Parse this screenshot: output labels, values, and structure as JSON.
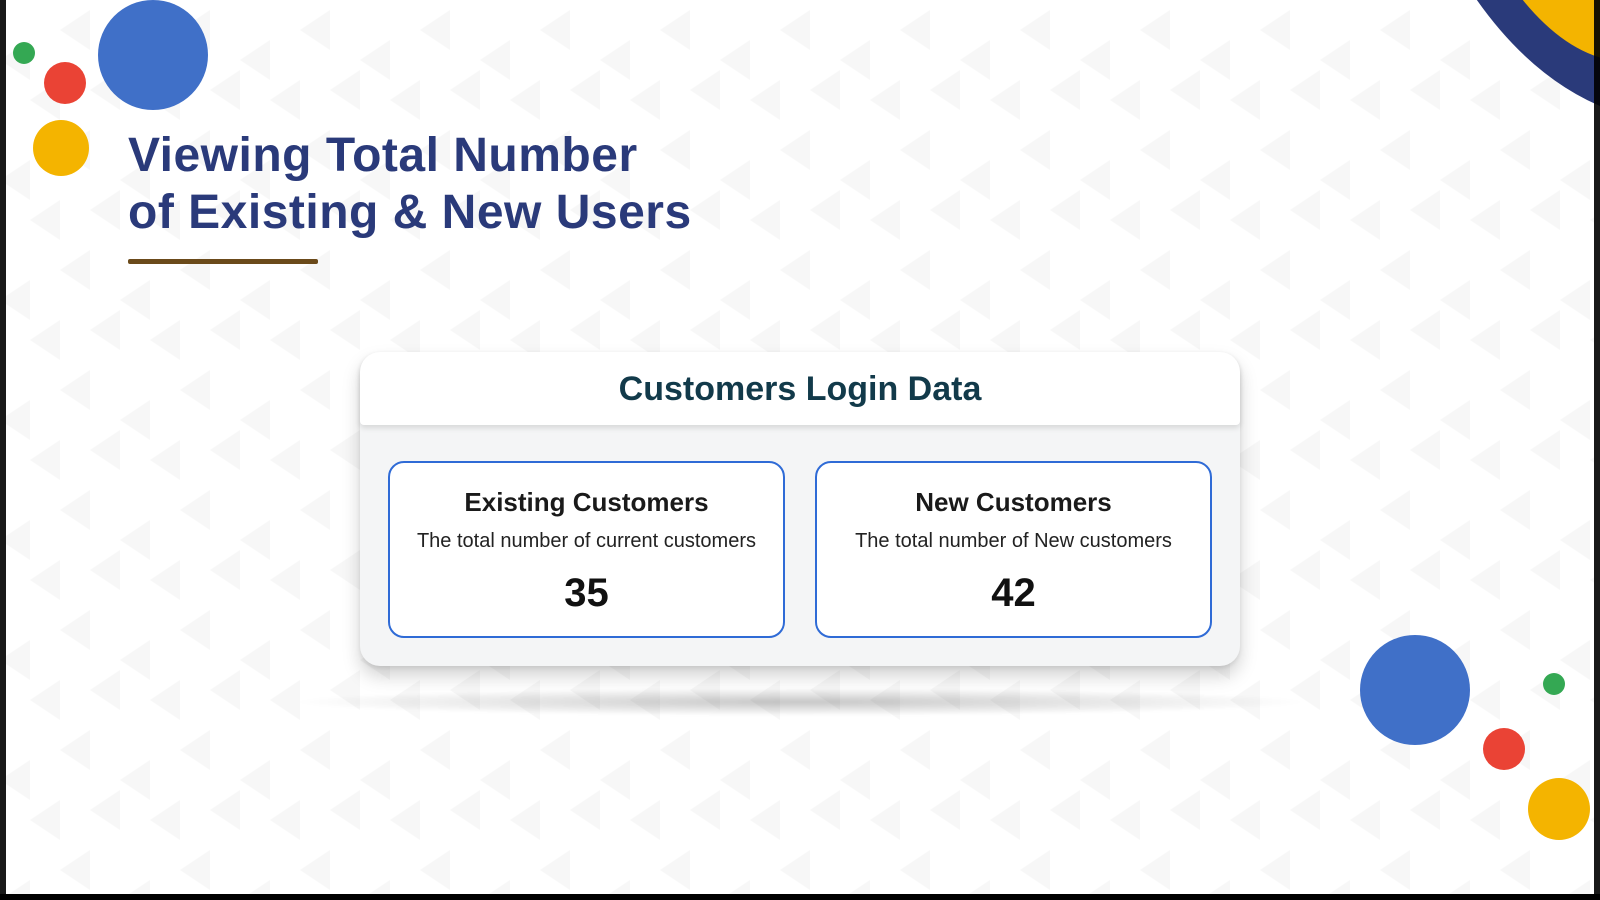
{
  "title": {
    "line1": "Viewing Total Number",
    "line2": "of Existing & New Users"
  },
  "panel": {
    "heading": "Customers Login Data",
    "cards": [
      {
        "title": "Existing Customers",
        "description": "The total number of current customers",
        "value": "35"
      },
      {
        "title": "New Customers",
        "description": "The total number of New customers",
        "value": "42"
      }
    ]
  },
  "colors": {
    "brand_blue": "#4070c8",
    "brand_red": "#ea4335",
    "brand_green": "#34a853",
    "brand_gold": "#f4b400",
    "title_navy": "#2a3a7a",
    "panel_teal": "#123a4a",
    "card_border": "#2f6bd6"
  }
}
